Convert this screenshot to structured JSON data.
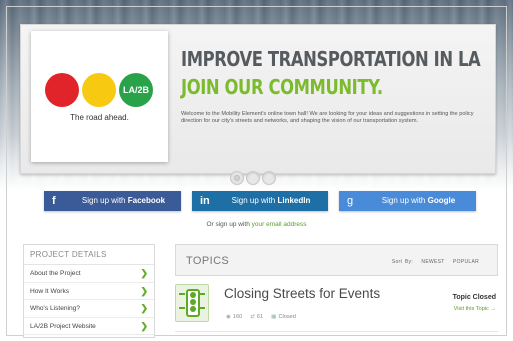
{
  "hero": {
    "logo_badge": "LA/2B",
    "logo_tagline": "The road ahead.",
    "title": "IMPROVE TRANSPORTATION IN LA",
    "subtitle": "JOIN OUR COMMUNITY.",
    "description": "Welcome to the Mobility Element's online town hall! We are looking for your ideas and suggestions in setting the policy direction for our city's streets and networks, and shaping the vision of our transportation system."
  },
  "signup": {
    "facebook_prefix": "Sign up with",
    "facebook_name": "Facebook",
    "linkedin_prefix": "Sign up with",
    "linkedin_name": "LinkedIn",
    "google_prefix": "Sign up with",
    "google_name": "Google",
    "or_text": "Or sign up with",
    "email_link": "your email address"
  },
  "project": {
    "heading": "PROJECT DETAILS",
    "items": [
      {
        "label": "About the Project"
      },
      {
        "label": "How It Works"
      },
      {
        "label": "Who's Listening?"
      },
      {
        "label": "LA/2B Project Website"
      }
    ]
  },
  "topics": {
    "heading": "TOPICS",
    "sort_label": "Sort By:",
    "sort_newest": "NEWEST",
    "sort_popular": "POPULAR",
    "rows": [
      {
        "title": "Closing Streets for Events",
        "views": "160",
        "comments": "61",
        "state": "Closed",
        "status": "Topic Closed",
        "visit": "Visit this Topic →"
      }
    ]
  },
  "colors": {
    "accent_green": "#7dbb2e",
    "facebook": "#3b5b98",
    "linkedin": "#1d6fa5",
    "google": "#4a8bd9"
  }
}
